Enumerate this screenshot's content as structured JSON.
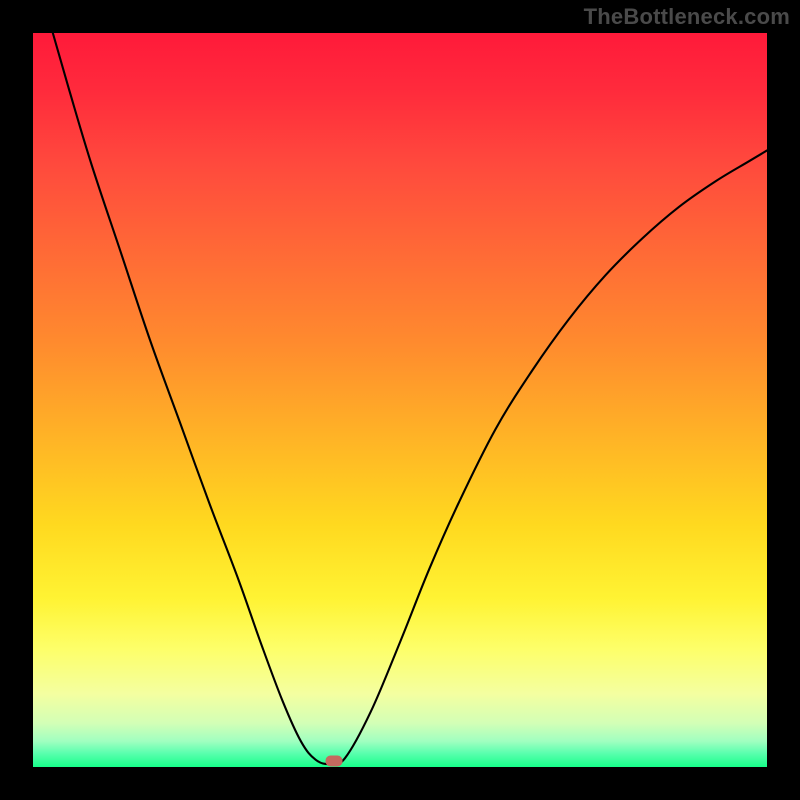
{
  "watermark": "TheBottleneck.com",
  "chart_data": {
    "type": "line",
    "title": "",
    "xlabel": "",
    "ylabel": "",
    "xlim": [
      0,
      100
    ],
    "ylim": [
      0,
      100
    ],
    "series": [
      {
        "name": "bottleneck-curve",
        "points": [
          {
            "x": 2.7,
            "y": 100.0
          },
          {
            "x": 5.0,
            "y": 92.0
          },
          {
            "x": 8.0,
            "y": 82.0
          },
          {
            "x": 12.0,
            "y": 70.0
          },
          {
            "x": 16.0,
            "y": 58.0
          },
          {
            "x": 20.0,
            "y": 47.0
          },
          {
            "x": 24.0,
            "y": 36.0
          },
          {
            "x": 28.0,
            "y": 25.5
          },
          {
            "x": 31.0,
            "y": 17.0
          },
          {
            "x": 34.0,
            "y": 9.0
          },
          {
            "x": 36.5,
            "y": 3.5
          },
          {
            "x": 38.5,
            "y": 1.0
          },
          {
            "x": 40.5,
            "y": 0.4
          },
          {
            "x": 42.5,
            "y": 1.2
          },
          {
            "x": 46.0,
            "y": 7.5
          },
          {
            "x": 50.0,
            "y": 17.0
          },
          {
            "x": 54.0,
            "y": 27.0
          },
          {
            "x": 58.0,
            "y": 36.0
          },
          {
            "x": 63.0,
            "y": 46.0
          },
          {
            "x": 68.0,
            "y": 54.0
          },
          {
            "x": 73.0,
            "y": 61.0
          },
          {
            "x": 78.0,
            "y": 67.0
          },
          {
            "x": 83.0,
            "y": 72.0
          },
          {
            "x": 88.0,
            "y": 76.3
          },
          {
            "x": 93.0,
            "y": 79.8
          },
          {
            "x": 97.5,
            "y": 82.5
          },
          {
            "x": 100.0,
            "y": 84.0
          }
        ]
      }
    ],
    "marker": {
      "x": 41.0,
      "y": 0.8,
      "color": "#c46a5f"
    },
    "background_gradient": {
      "top": "#ff1a3a",
      "bottom": "#17ff8a"
    }
  }
}
